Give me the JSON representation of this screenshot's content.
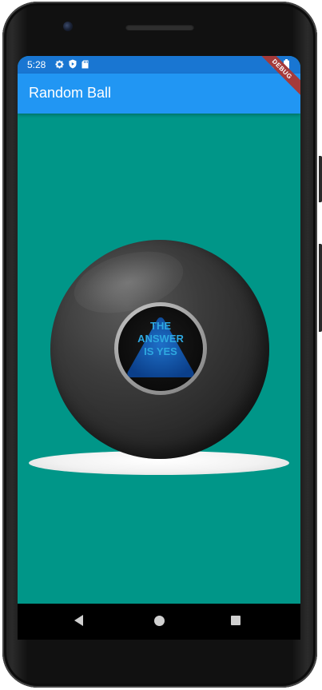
{
  "status_bar": {
    "time": "5:28",
    "left_icons": [
      "gear-icon",
      "shield-icon",
      "sd-card-icon"
    ],
    "right_icons": [
      "wifi-icon",
      "battery-icon"
    ],
    "color": "#1976D2"
  },
  "app_bar": {
    "title": "Random Ball",
    "color": "#2196F3"
  },
  "debug_banner": {
    "label": "DEBUG"
  },
  "content": {
    "background_color": "#009688",
    "magic_ball": {
      "answer_lines": [
        "THE",
        "ANSWER",
        "IS YES"
      ]
    }
  },
  "nav_bar": {
    "buttons": [
      "back-icon",
      "home-icon",
      "recents-icon"
    ]
  }
}
